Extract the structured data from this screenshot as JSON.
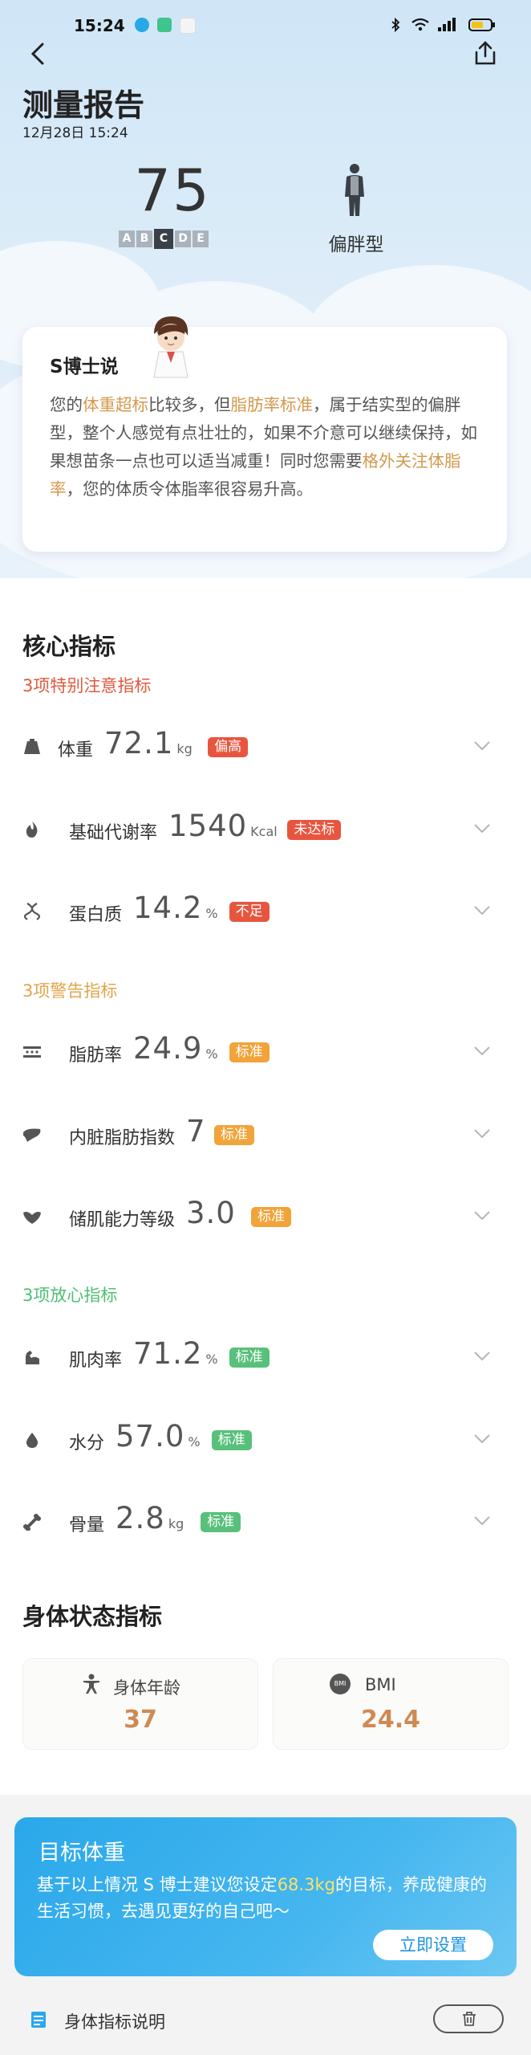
{
  "status_bar": {
    "time": "15:24"
  },
  "header": {
    "title": "测量报告",
    "date": "12月28日 15:24",
    "score": "75",
    "grades": [
      "A",
      "B",
      "C",
      "D",
      "E"
    ],
    "active_grade": "C",
    "body_type": "偏胖型"
  },
  "doctor": {
    "title": "S博士说",
    "text_parts": [
      {
        "t": "您的",
        "hl": false
      },
      {
        "t": "体重超标",
        "hl": true
      },
      {
        "t": "比较多，但",
        "hl": false
      },
      {
        "t": "脂肪率标准",
        "hl": true
      },
      {
        "t": "，属于结实型的偏胖型，整个人感觉有点壮壮的，如果不介意可以继续保持，如果想苗条一点也可以适当减重！同时您需要",
        "hl": false
      },
      {
        "t": "格外关注体脂率",
        "hl": true
      },
      {
        "t": "，您的体质令体脂率很容易升高。",
        "hl": false
      }
    ]
  },
  "core": {
    "title": "核心指标",
    "groups": [
      {
        "title": "3项特别注意指标",
        "color": "#e0593f",
        "items": [
          {
            "icon": "weight-icon",
            "label": "体重",
            "value": "72.1",
            "unit": "kg",
            "badge": "偏高",
            "badge_color": "red"
          },
          {
            "icon": "flame-icon",
            "label": "基础代谢率",
            "value": "1540",
            "unit": "Kcal",
            "badge": "未达标",
            "badge_color": "red"
          },
          {
            "icon": "dna-icon",
            "label": "蛋白质",
            "value": "14.2",
            "unit": "%",
            "badge": "不足",
            "badge_color": "red"
          }
        ]
      },
      {
        "title": "3项警告指标",
        "color": "#e0a54a",
        "items": [
          {
            "icon": "fat-icon",
            "label": "脂肪率",
            "value": "24.9",
            "unit": "%",
            "badge": "标准",
            "badge_color": "orange"
          },
          {
            "icon": "liver-icon",
            "label": "内脏脂肪指数",
            "value": "7",
            "unit": "",
            "badge": "标准",
            "badge_color": "orange"
          },
          {
            "icon": "muscle-storage-icon",
            "label": "储肌能力等级",
            "value": "3.0",
            "unit": "",
            "badge": "标准",
            "badge_color": "orange"
          }
        ]
      },
      {
        "title": "3项放心指标",
        "color": "#4fbf74",
        "items": [
          {
            "icon": "arm-muscle-icon",
            "label": "肌肉率",
            "value": "71.2",
            "unit": "%",
            "badge": "标准",
            "badge_color": "green"
          },
          {
            "icon": "water-drop-icon",
            "label": "水分",
            "value": "57.0",
            "unit": "%",
            "badge": "标准",
            "badge_color": "green"
          },
          {
            "icon": "bone-icon",
            "label": "骨量",
            "value": "2.8",
            "unit": "kg",
            "badge": "标准",
            "badge_color": "green"
          }
        ]
      }
    ]
  },
  "body_status": {
    "title": "身体状态指标",
    "age_label": "身体年龄",
    "age_value": "37",
    "bmi_icon_text": "BMI",
    "bmi_label": "BMI",
    "bmi_value": "24.4"
  },
  "target": {
    "title": "目标体重",
    "text_before": "基于以上情况 S 博士建议您设定",
    "kg": "68.3kg",
    "text_after": "的目标，养成健康的生活习惯，去遇见更好的自己吧～",
    "button": "立即设置"
  },
  "footer": {
    "explain_label": "身体指标说明"
  },
  "colors": {
    "red": "#e8553f",
    "orange": "#f1a43a",
    "green": "#58c07a",
    "accent_blue": "#2aa8ea",
    "value_orange": "#cf8a54"
  }
}
